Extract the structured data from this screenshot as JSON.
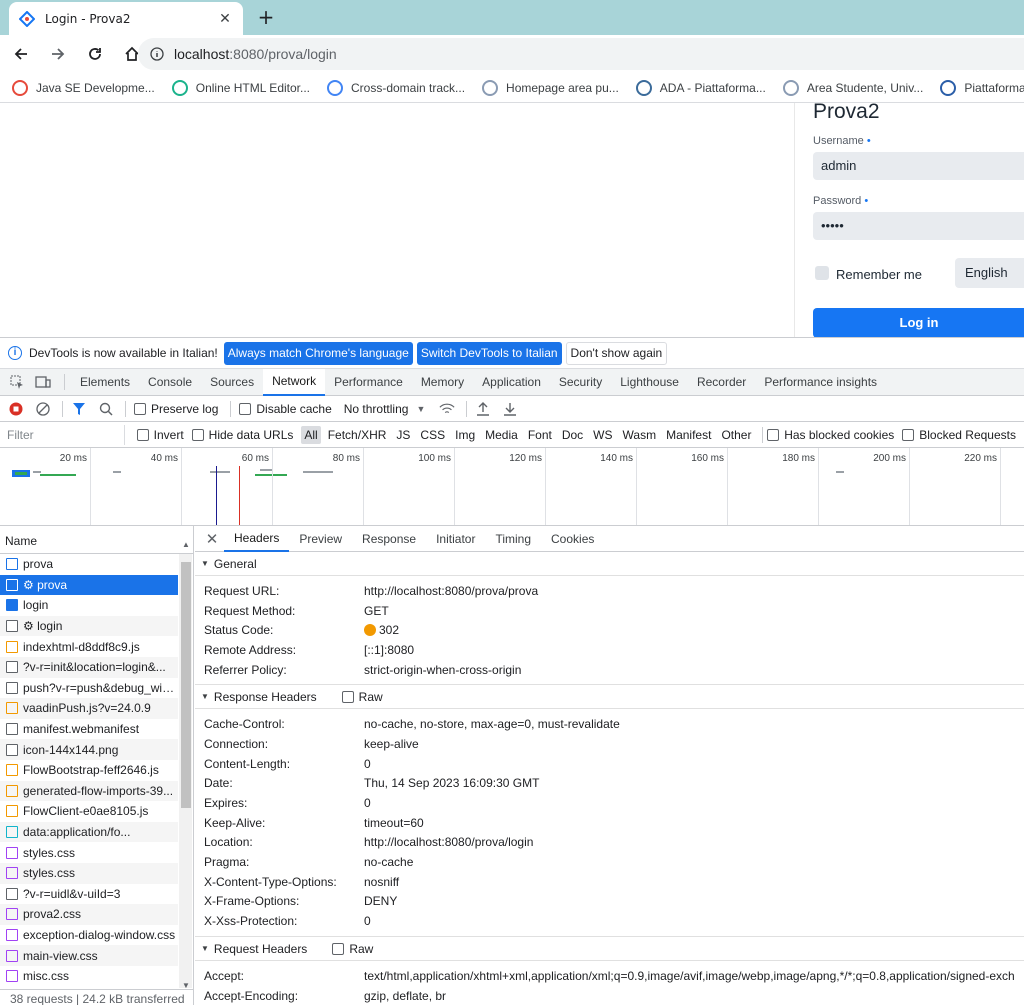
{
  "browser": {
    "tab_title": "Login - Prova2",
    "url_host": "localhost",
    "url_rest": ":8080/prova/login",
    "bookmarks": [
      {
        "label": "Java SE Developme...",
        "icon": "oracle-icon",
        "color": "#e64a3b"
      },
      {
        "label": "Online HTML Editor...",
        "icon": "editor-icon",
        "color": "#1bb38c"
      },
      {
        "label": "Cross-domain track...",
        "icon": "google-icon",
        "color": "#4285f4"
      },
      {
        "label": "Homepage area pu...",
        "icon": "globe-icon",
        "color": "#8a9bb3"
      },
      {
        "label": "ADA - Piattaforma...",
        "icon": "ada-icon",
        "color": "#3b6b9a"
      },
      {
        "label": "Area Studente, Univ...",
        "icon": "globe-icon",
        "color": "#8a9bb3"
      },
      {
        "label": "Piattaforma CUBA...",
        "icon": "cuba-icon",
        "color": "#2b5ea8"
      }
    ]
  },
  "login": {
    "title": "Prova2",
    "username_label": "Username",
    "username_value": "admin",
    "password_label": "Password",
    "password_value": "•••••",
    "required_marker": "•",
    "remember_label": "Remember me",
    "language": "English",
    "login_button": "Log in"
  },
  "devtools": {
    "infobar": {
      "text": "DevTools is now available in Italian!",
      "btn_match": "Always match Chrome's language",
      "btn_switch": "Switch DevTools to Italian",
      "btn_dismiss": "Don't show again"
    },
    "tabs": [
      "Elements",
      "Console",
      "Sources",
      "Network",
      "Performance",
      "Memory",
      "Application",
      "Security",
      "Lighthouse",
      "Recorder",
      "Performance insights"
    ],
    "active_tab": "Network",
    "toolbar": {
      "preserve_log": "Preserve log",
      "disable_cache": "Disable cache",
      "throttling": "No throttling"
    },
    "filter": {
      "placeholder": "Filter",
      "invert": "Invert",
      "hide_data_urls": "Hide data URLs",
      "types": [
        "All",
        "Fetch/XHR",
        "JS",
        "CSS",
        "Img",
        "Media",
        "Font",
        "Doc",
        "WS",
        "Wasm",
        "Manifest",
        "Other"
      ],
      "active_type": "All",
      "blocked_cookies": "Has blocked cookies",
      "blocked_requests": "Blocked Requests"
    },
    "overview_ticks": [
      "20 ms",
      "40 ms",
      "60 ms",
      "80 ms",
      "100 ms",
      "120 ms",
      "140 ms",
      "160 ms",
      "180 ms",
      "200 ms",
      "220 ms"
    ],
    "requests_header": "Name",
    "requests": [
      {
        "name": "prova",
        "type": "doc",
        "selected": false
      },
      {
        "name": "⚙ prova",
        "type": "other",
        "selected": true
      },
      {
        "name": "login",
        "type": "doc-filled",
        "selected": false
      },
      {
        "name": "⚙ login",
        "type": "other",
        "selected": false
      },
      {
        "name": "indexhtml-d8ddf8c9.js",
        "type": "script",
        "selected": false
      },
      {
        "name": "?v-r=init&location=login&...",
        "type": "other",
        "selected": false
      },
      {
        "name": "push?v-r=push&debug_win...",
        "type": "other",
        "selected": false
      },
      {
        "name": "vaadinPush.js?v=24.0.9",
        "type": "script",
        "selected": false
      },
      {
        "name": "manifest.webmanifest",
        "type": "other",
        "selected": false
      },
      {
        "name": "icon-144x144.png",
        "type": "other",
        "selected": false
      },
      {
        "name": "FlowBootstrap-feff2646.js",
        "type": "script",
        "selected": false
      },
      {
        "name": "generated-flow-imports-39...",
        "type": "script",
        "selected": false
      },
      {
        "name": "FlowClient-e0ae8105.js",
        "type": "script",
        "selected": false
      },
      {
        "name": "data:application/fo...",
        "type": "font",
        "selected": false
      },
      {
        "name": "styles.css",
        "type": "css",
        "selected": false
      },
      {
        "name": "styles.css",
        "type": "css",
        "selected": false
      },
      {
        "name": "?v-r=uidl&v-uiId=3",
        "type": "other",
        "selected": false
      },
      {
        "name": "prova2.css",
        "type": "css",
        "selected": false
      },
      {
        "name": "exception-dialog-window.css",
        "type": "css",
        "selected": false
      },
      {
        "name": "main-view.css",
        "type": "css",
        "selected": false
      },
      {
        "name": "misc.css",
        "type": "css",
        "selected": false
      }
    ],
    "status_bar": "38 requests  |  24.2 kB transferred",
    "detail_tabs": [
      "Headers",
      "Preview",
      "Response",
      "Initiator",
      "Timing",
      "Cookies"
    ],
    "active_detail_tab": "Headers",
    "general": {
      "title": "General",
      "rows": [
        {
          "k": "Request URL:",
          "v": "http://localhost:8080/prova/prova"
        },
        {
          "k": "Request Method:",
          "v": "GET"
        },
        {
          "k": "Status Code:",
          "v": "302"
        },
        {
          "k": "Remote Address:",
          "v": "[::1]:8080"
        },
        {
          "k": "Referrer Policy:",
          "v": "strict-origin-when-cross-origin"
        }
      ]
    },
    "response_headers": {
      "title": "Response Headers",
      "raw": "Raw",
      "rows": [
        {
          "k": "Cache-Control:",
          "v": "no-cache, no-store, max-age=0, must-revalidate"
        },
        {
          "k": "Connection:",
          "v": "keep-alive"
        },
        {
          "k": "Content-Length:",
          "v": "0"
        },
        {
          "k": "Date:",
          "v": "Thu, 14 Sep 2023 16:09:30 GMT"
        },
        {
          "k": "Expires:",
          "v": "0"
        },
        {
          "k": "Keep-Alive:",
          "v": "timeout=60"
        },
        {
          "k": "Location:",
          "v": "http://localhost:8080/prova/login"
        },
        {
          "k": "Pragma:",
          "v": "no-cache"
        },
        {
          "k": "X-Content-Type-Options:",
          "v": "nosniff"
        },
        {
          "k": "X-Frame-Options:",
          "v": "DENY"
        },
        {
          "k": "X-Xss-Protection:",
          "v": "0"
        }
      ]
    },
    "request_headers": {
      "title": "Request Headers",
      "raw": "Raw",
      "rows": [
        {
          "k": "Accept:",
          "v": "text/html,application/xhtml+xml,application/xml;q=0.9,image/avif,image/webp,image/apng,*/*;q=0.8,application/signed-exch"
        },
        {
          "k": "Accept-Encoding:",
          "v": "gzip, deflate, br"
        }
      ]
    }
  }
}
